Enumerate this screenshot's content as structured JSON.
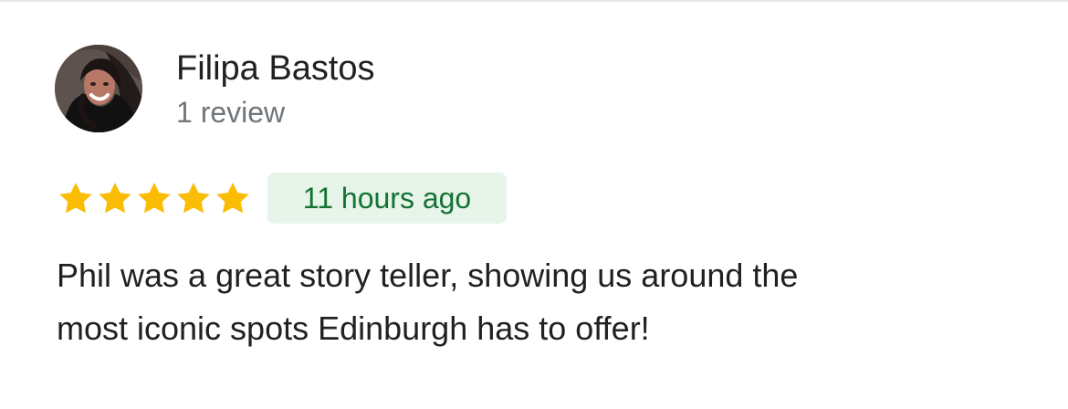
{
  "review": {
    "reviewer_name": "Filipa Bastos",
    "review_count": "1 review",
    "rating": 5,
    "time_ago": "11 hours ago",
    "text_lines": [
      "Phil was a great story teller, showing us around the",
      "most iconic spots Edinburgh has to offer!"
    ]
  },
  "colors": {
    "star": "#fbbc04",
    "badge_background": "#e6f4ea",
    "badge_text": "#137333",
    "primary_text": "#202124",
    "secondary_text": "#70757a"
  },
  "icons": {
    "star": "star-icon",
    "avatar": "avatar"
  }
}
